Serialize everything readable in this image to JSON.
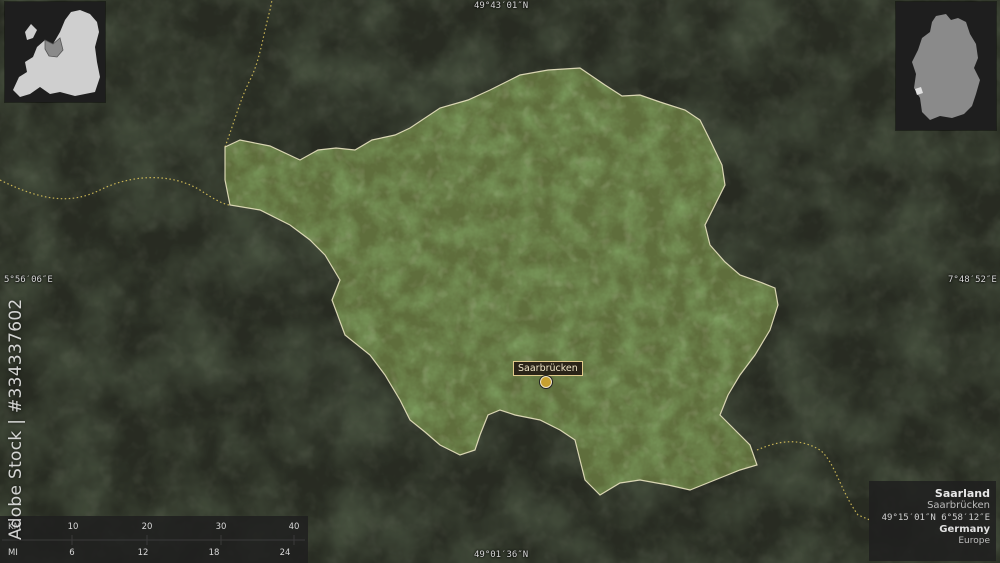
{
  "map": {
    "colors": {
      "background": "#2e3228",
      "region_fill": "#5f6e3c",
      "region_border": "#e8e2c0",
      "border_dotted": "#d8c15a"
    },
    "coordinates": {
      "top": "49°43′01″N",
      "bottom": "49°01′36″N",
      "left": "5°56′06″E",
      "right": "7°48′52″E"
    },
    "place": {
      "name": "Saarbrücken",
      "marker_icon": "circle-marker-icon"
    }
  },
  "info": {
    "region": "Saarland",
    "capital": "Saarbrücken",
    "coords": "49°15′01″N 6°58′12″E",
    "country": "Germany",
    "continent": "Europe"
  },
  "scale": {
    "km_label": "KM",
    "mi_label": "MI",
    "km_ticks": [
      "10",
      "20",
      "30",
      "40"
    ],
    "mi_ticks": [
      "6",
      "12",
      "18",
      "24"
    ]
  },
  "watermark": "Adobe Stock | #334337602"
}
